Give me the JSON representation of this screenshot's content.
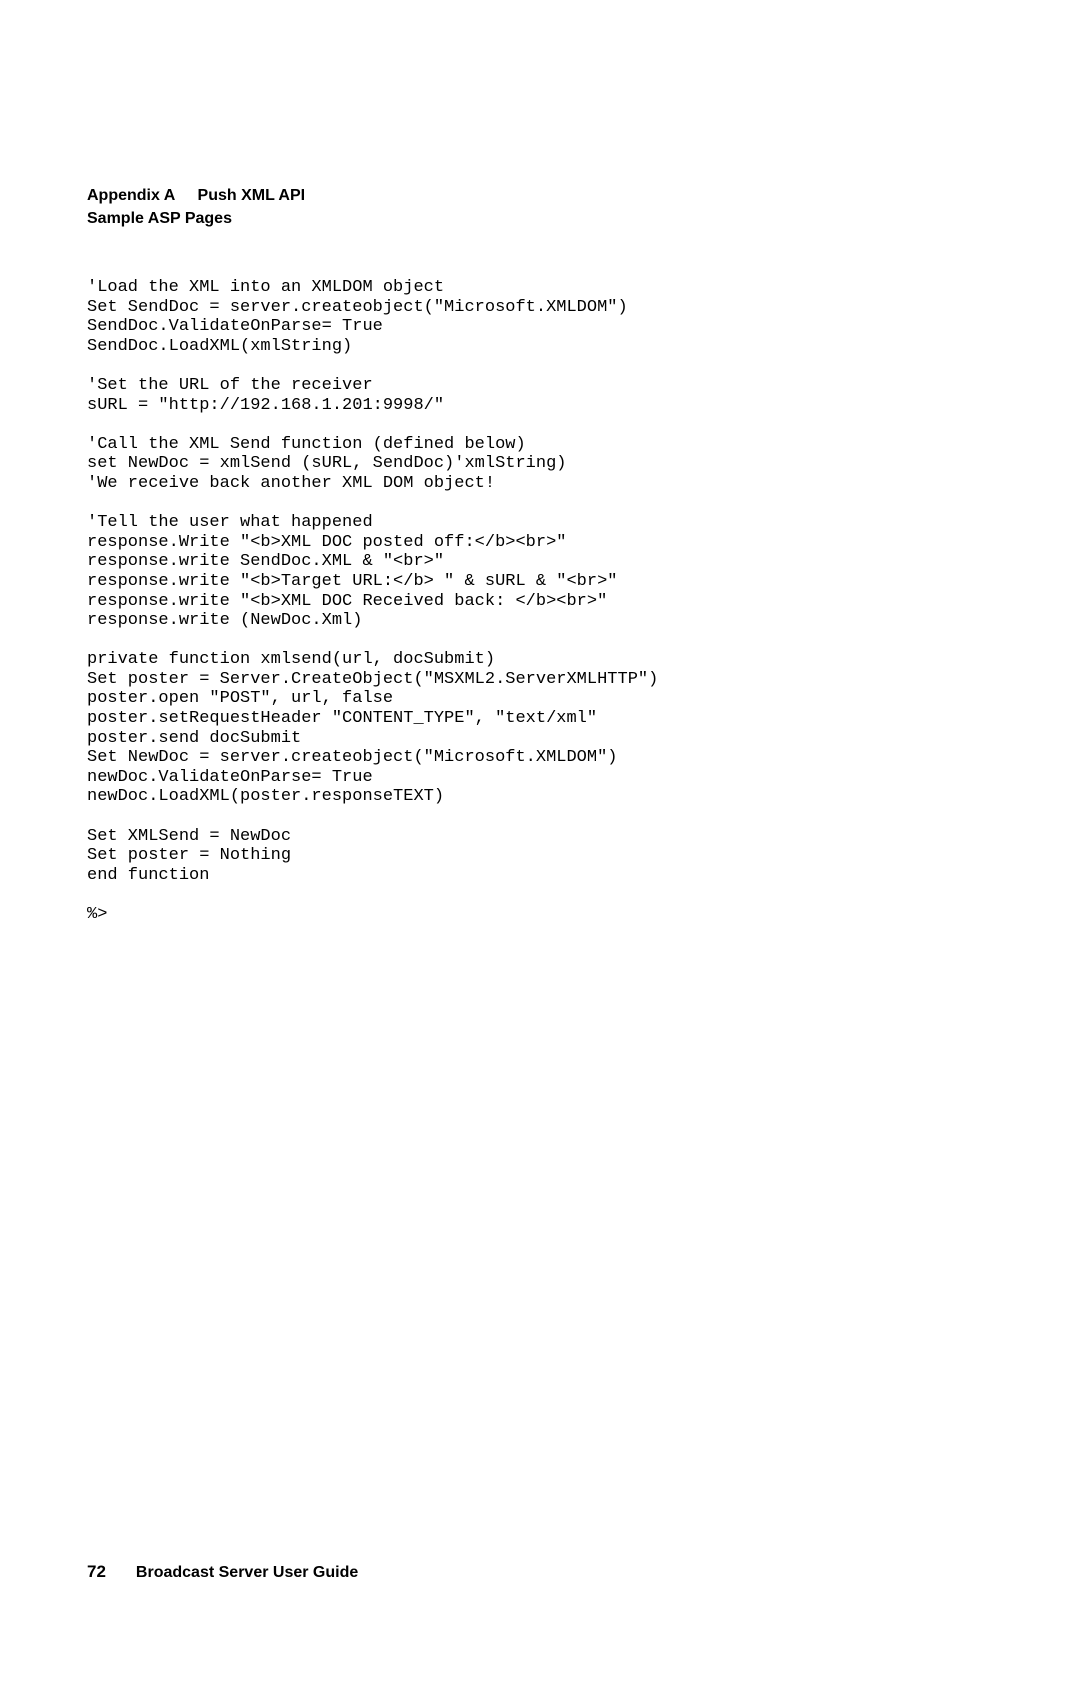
{
  "header": {
    "line1a": "Appendix A",
    "line1b": "Push XML API",
    "line2": "Sample ASP Pages"
  },
  "code": "'Load the XML into an XMLDOM object\nSet SendDoc = server.createobject(\"Microsoft.XMLDOM\")\nSendDoc.ValidateOnParse= True\nSendDoc.LoadXML(xmlString)\n\n'Set the URL of the receiver\nsURL = \"http://192.168.1.201:9998/\"\n\n'Call the XML Send function (defined below)\nset NewDoc = xmlSend (sURL, SendDoc)'xmlString)\n'We receive back another XML DOM object!\n\n'Tell the user what happened\nresponse.Write \"<b>XML DOC posted off:</b><br>\"\nresponse.write SendDoc.XML & \"<br>\"\nresponse.write \"<b>Target URL:</b> \" & sURL & \"<br>\"\nresponse.write \"<b>XML DOC Received back: </b><br>\"\nresponse.write (NewDoc.Xml)\n\nprivate function xmlsend(url, docSubmit)\nSet poster = Server.CreateObject(\"MSXML2.ServerXMLHTTP\")\nposter.open \"POST\", url, false\nposter.setRequestHeader \"CONTENT_TYPE\", \"text/xml\"\nposter.send docSubmit\nSet NewDoc = server.createobject(\"Microsoft.XMLDOM\")\nnewDoc.ValidateOnParse= True\nnewDoc.LoadXML(poster.responseTEXT)\n\nSet XMLSend = NewDoc\nSet poster = Nothing\nend function\n\n%>",
  "footer": {
    "pageNumber": "72",
    "title": "Broadcast Server User Guide"
  }
}
